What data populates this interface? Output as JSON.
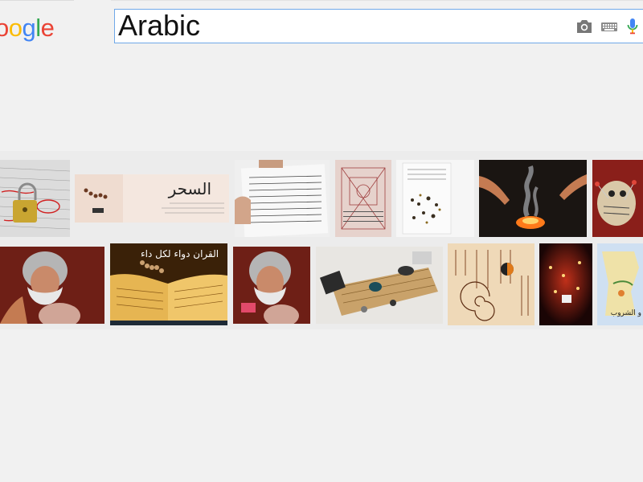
{
  "logo": {
    "visible_letters": [
      "o",
      "o",
      "g",
      "l",
      "e"
    ],
    "colors": [
      "#ea4335",
      "#fbbc05",
      "#4285f4",
      "#34a853",
      "#ea4335"
    ]
  },
  "search": {
    "query": "Arabic"
  },
  "icons": [
    "camera-icon",
    "keyboard-icon",
    "microphone-icon"
  ],
  "results": {
    "row1": [
      {
        "name": "red-marked-paper-padlock"
      },
      {
        "name": "sihr-banner",
        "text": "السحر"
      },
      {
        "name": "handwritten-talisman-paper"
      },
      {
        "name": "talisman-grid-sheet"
      },
      {
        "name": "herbs-on-talisman-paper"
      },
      {
        "name": "smoking-ritual-hands"
      },
      {
        "name": "voodoo-doll"
      }
    ],
    "row2": [
      {
        "name": "old-man-crystal-ball"
      },
      {
        "name": "quran-rosary",
        "text": "القران دواء لكل داء"
      },
      {
        "name": "old-man-crystal-ball-2"
      },
      {
        "name": "ritual-objects-on-mat"
      },
      {
        "name": "chinese-talisman-scroll"
      },
      {
        "name": "candles-in-dark"
      },
      {
        "name": "map-partial",
        "text": "و الشروب"
      }
    ]
  }
}
